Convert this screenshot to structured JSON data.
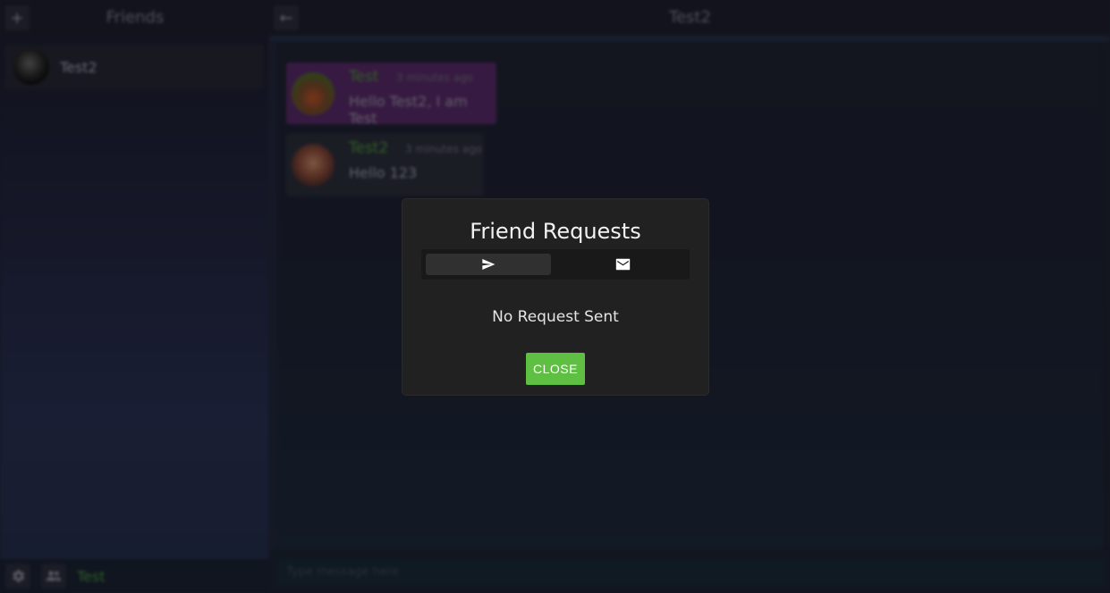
{
  "sidebar": {
    "title": "Friends",
    "add_icon": "plus-icon",
    "friends": [
      {
        "name": "Test2"
      }
    ],
    "footer": {
      "settings_icon": "gear-icon",
      "friends_icon": "people-icon",
      "username": "Test"
    }
  },
  "chat": {
    "back_icon": "arrow-left-icon",
    "title": "Test2",
    "messages": [
      {
        "author": "Test",
        "time": "3 minutes ago",
        "text": "Hello Test2, I am Test"
      },
      {
        "author": "Test2",
        "time": "3 minutes ago",
        "text": "Hello 123"
      }
    ],
    "input_placeholder": "Type message here"
  },
  "dialog": {
    "title": "Friend Requests",
    "tabs": [
      {
        "icon": "send-icon",
        "active": true
      },
      {
        "icon": "mail-icon",
        "active": false
      }
    ],
    "empty_text": "No Request Sent",
    "close_label": "CLOSE"
  },
  "colors": {
    "accent_green": "#5fbf42",
    "username_green": "#4c9a3a",
    "own_message_bg": "#6a2a7a",
    "other_message_bg": "#2c2f3d"
  }
}
